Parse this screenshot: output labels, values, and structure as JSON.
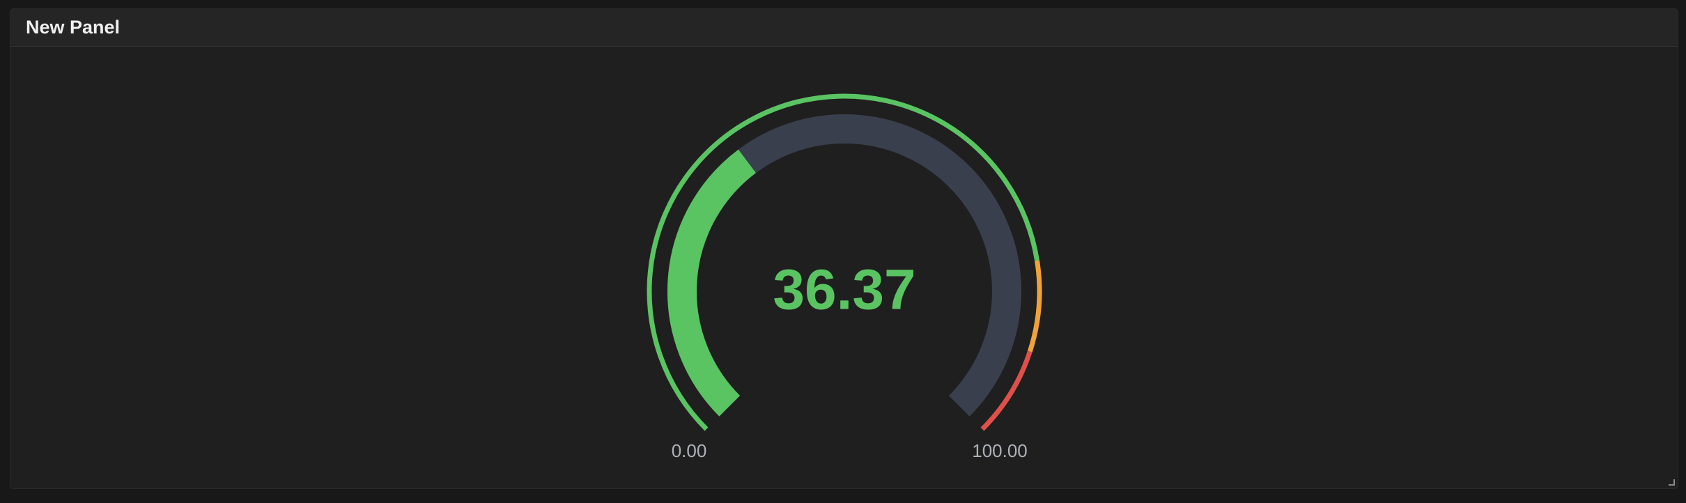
{
  "panel": {
    "title": "New Panel"
  },
  "gauge": {
    "value": 36.37,
    "value_text": "36.37",
    "min": 0,
    "max": 100,
    "min_label": "0.00",
    "max_label": "100.00",
    "thresholds": [
      {
        "from": 0,
        "to": 80,
        "color": "#5ac463"
      },
      {
        "from": 80,
        "to": 90,
        "color": "#f0a23a"
      },
      {
        "from": 90,
        "to": 100,
        "color": "#e0504a"
      }
    ],
    "colors": {
      "value": "#5ac463",
      "track": "#3a3f4d",
      "labels": "#aeb2b8"
    }
  }
}
